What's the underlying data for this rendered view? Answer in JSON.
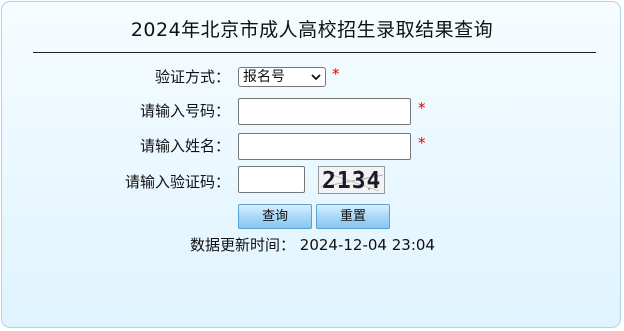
{
  "page": {
    "title": "2024年北京市成人高校招生录取结果查询"
  },
  "form": {
    "verify_method_label": "验证方式：",
    "verify_method_value": "报名号",
    "required_mark": "*",
    "reg_no_label": "请输入号码：",
    "name_label": "请输入姓名：",
    "captcha_label": "请输入验证码：",
    "captcha_text": "2134",
    "query_button": "查询",
    "reset_button": "重置"
  },
  "footer": {
    "update_label": "数据更新时间：",
    "update_value": "2024-12-04 23:04"
  },
  "colors": {
    "required": "#e00000",
    "panel_border": "#a9d6ee",
    "button_top": "#d8efff",
    "button_bottom": "#88c6f1"
  },
  "icons": {
    "select_arrow": "chevron-down-icon"
  }
}
